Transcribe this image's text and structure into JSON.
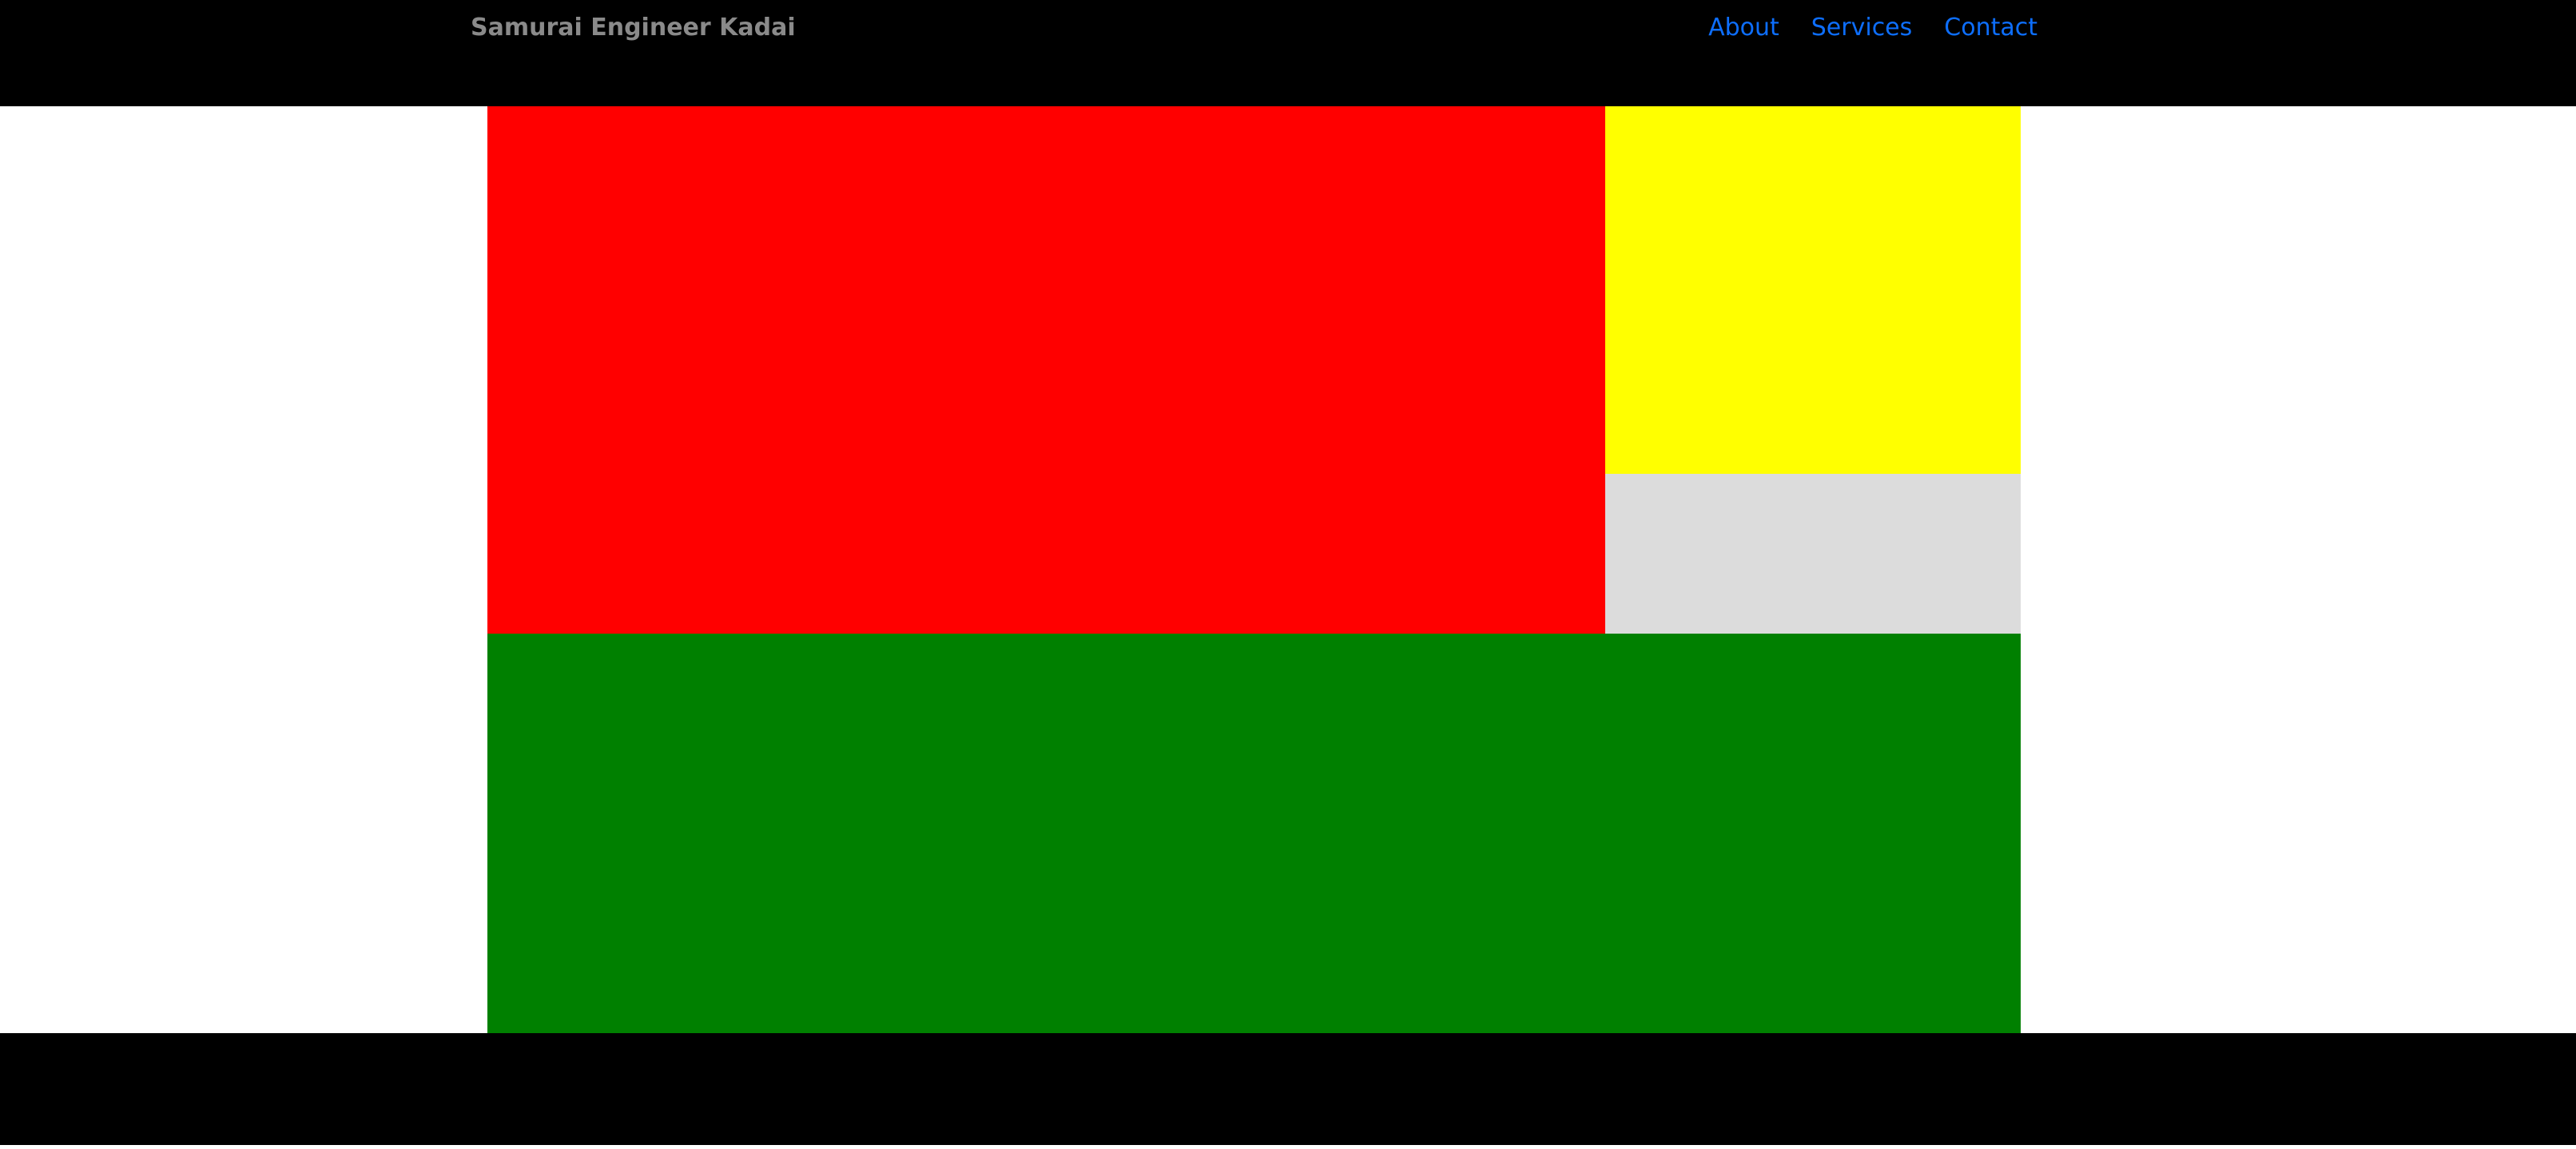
{
  "header": {
    "brand": "Samurai Engineer Kadai",
    "nav": [
      {
        "label": "About"
      },
      {
        "label": "Services"
      },
      {
        "label": "Contact"
      }
    ],
    "background": "#000000",
    "brand_color": "#8a8a8a",
    "link_color": "#0d6efd"
  },
  "layout": {
    "panels": [
      {
        "name": "red-panel",
        "color": "#ff0000"
      },
      {
        "name": "yellow-panel",
        "color": "#ffff00"
      },
      {
        "name": "gray-panel",
        "color": "#dcdcdc"
      },
      {
        "name": "green-panel",
        "color": "#008000"
      }
    ]
  },
  "footer": {
    "background": "#000000"
  }
}
